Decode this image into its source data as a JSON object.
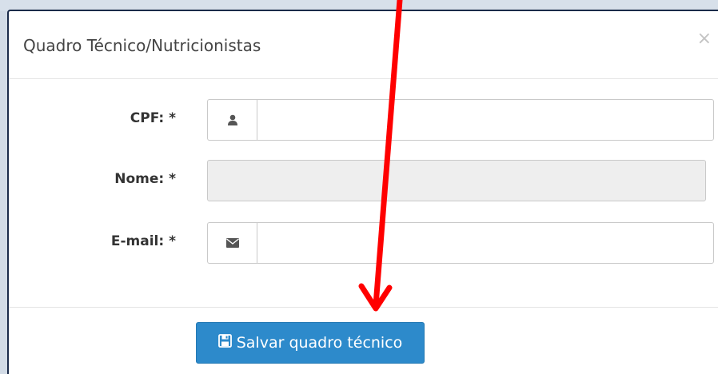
{
  "modal": {
    "title": "Quadro Técnico/Nutricionistas",
    "close_label": "×"
  },
  "form": {
    "cpf": {
      "label": "CPF: *",
      "icon": "user-icon",
      "value": ""
    },
    "nome": {
      "label": "Nome: *",
      "value": ""
    },
    "email": {
      "label": "E-mail: *",
      "icon": "envelope-icon",
      "value": ""
    }
  },
  "footer": {
    "save_label": "Salvar quadro técnico",
    "save_icon": "floppy-disk-icon"
  },
  "colors": {
    "primary": "#2d8acb",
    "annotation_arrow": "#ff0000",
    "readonly_bg": "#eeeeee"
  }
}
